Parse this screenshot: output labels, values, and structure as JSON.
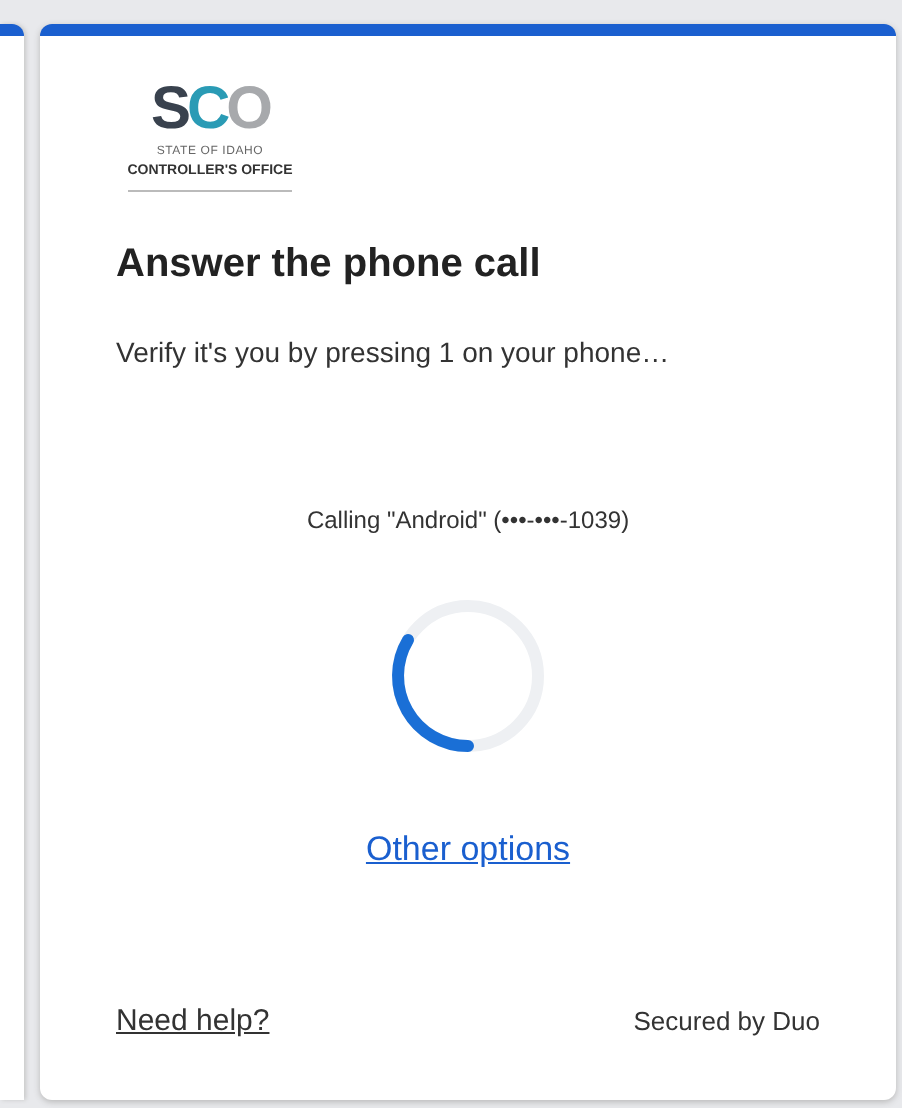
{
  "logo": {
    "letters": [
      {
        "text": "S",
        "color": "#39424e"
      },
      {
        "text": "C",
        "color": "#2a9bb5"
      },
      {
        "text": "O",
        "color": "#a7a9ac"
      }
    ],
    "line_1": "STATE OF IDAHO",
    "line_2": "CONTROLLER'S OFFICE"
  },
  "title": "Answer the phone call",
  "subtitle": "Verify it's you by pressing 1 on your phone…",
  "calling": "Calling \"Android\" (•••-•••-1039)",
  "other_options": "Other options",
  "footer": {
    "help_link": "Need help?",
    "secured": "Secured by Duo"
  }
}
